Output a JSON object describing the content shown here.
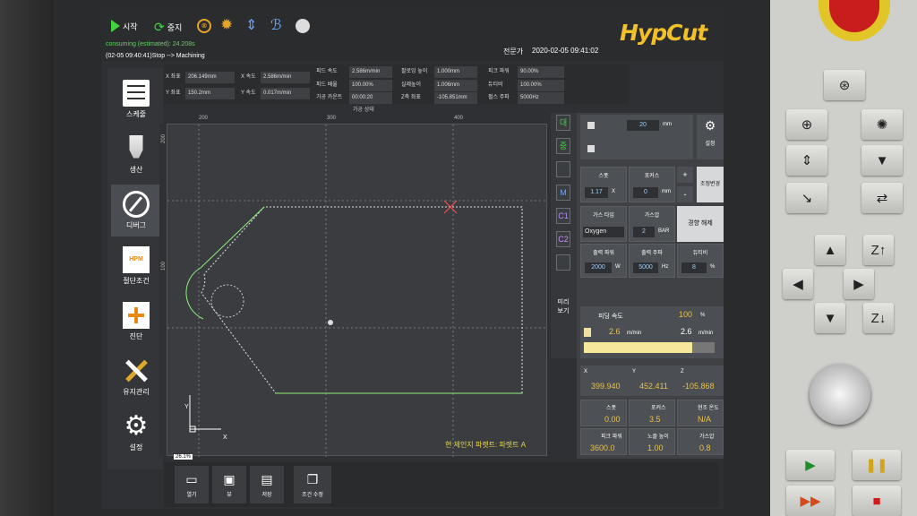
{
  "app": {
    "logo": "HypCut",
    "consuming": "consuming (estimated): 24.208s",
    "status_line": "(02-05 09:40:41)Stop --> Machining",
    "user": "전문가",
    "datetime": "2020-02-05  09:41:02"
  },
  "toolbar_top": {
    "start": "시작",
    "stop": "중지"
  },
  "sidebar": [
    "스케줄",
    "생산",
    "디버그",
    "절단조건",
    "진단",
    "유지관리",
    "설정"
  ],
  "sidebar_icons": {
    "hpm": "HPM"
  },
  "info": {
    "x_label": "X 좌표",
    "x_value": "206.149mm",
    "y_label": "Y 좌표",
    "y_value": "150.2mm",
    "xs_label": "X 속도",
    "xs_value": "2.586m/min",
    "ys_label": "Y 속도",
    "ys_value": "0.017m/min",
    "feed_label": "피드 속도",
    "feed_value": "2.586m/min",
    "rate_label": "피드 배율",
    "rate_value": "100.00%",
    "count_label": "가공 카운트",
    "count_value": "00:00:20",
    "follow_label": "팔로잉 높이",
    "follow_value": "1.000mm",
    "actual_label": "실제높이",
    "actual_value": "1.006mm",
    "z_label": "Z축 좌표",
    "z_value": "-105.851mm",
    "peak_label": "피크 파워",
    "peak_value": "90.00%",
    "duty_label": "듀티비",
    "duty_value": "100.00%",
    "pulse_label": "펄스 주파",
    "pulse_value": "5000Hz",
    "state_label": "가공 상태"
  },
  "ruler": {
    "h": [
      "200",
      "300",
      "400"
    ],
    "v": [
      "200",
      "100"
    ]
  },
  "canvas": {
    "footer": "현 제인지 파렛트: 파렛트 A",
    "zoom": "26.1%",
    "axis_x": "X",
    "axis_y": "Y"
  },
  "right": {
    "tab_labels": [
      "대",
      "중",
      "",
      "M",
      "C1",
      "C2",
      ""
    ],
    "preview": "미리\n보기",
    "offset_value": "20",
    "offset_unit": "mm",
    "settings": "설정",
    "gap_label": "스폿",
    "gap_value": "1.17",
    "gap_unit": "X",
    "focus_label": "포커스",
    "focus_value": "0",
    "focus_unit": "mm",
    "plus": "+",
    "minus": "-",
    "cond_change": "조정변경",
    "gas_label": "가스 타입",
    "gas_value": "Oxygen",
    "press_label": "가스압",
    "press_value": "2",
    "press_unit": "BAR",
    "fault_label": "경향 해제",
    "power_label": "출력 파워",
    "power_value": "2000",
    "power_unit": "W",
    "freq_label": "출력 주파",
    "freq_value": "5000",
    "freq_unit": "Hz",
    "duty_label": "듀티비",
    "duty_value": "8",
    "duty_unit": "%",
    "speed_label": "피딩 속도",
    "speed_pct": "100",
    "speed_pct_unit": "%",
    "speed_a": "2.6",
    "speed_b": "2.6",
    "speed_unit": "m/min",
    "coord_x_label": "X",
    "coord_y_label": "Y",
    "coord_z_label": "Z",
    "coord_unit": "mm",
    "coord_x": "399.940",
    "coord_y": "452.411",
    "coord_z": "-105.868",
    "g1_label": "스폿",
    "g1_value": "0.00",
    "g1_unit": "X",
    "g2_label": "포커스",
    "g2_value": "3.5",
    "g2_unit": "mm",
    "g3_label": "현조 온도",
    "g3_value": "N/A",
    "g3_unit": "C",
    "g4_label": "피크 파워",
    "g4_value": "3600.0",
    "g4_unit": "W",
    "g5_label": "노즐 높이",
    "g5_value": "1.00",
    "g5_unit": "mm",
    "g6_label": "가스압",
    "g6_value": "0.8",
    "g6_unit": "BAR"
  },
  "bottom": [
    "열기",
    "뷰",
    "저장",
    "조건 수정"
  ]
}
